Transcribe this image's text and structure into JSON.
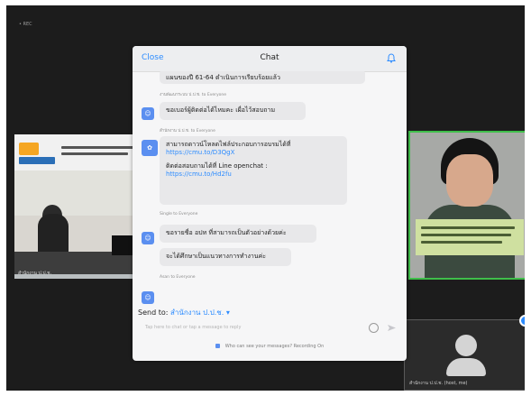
{
  "app": {
    "top_left_label": "• REC"
  },
  "left_video": {
    "label": "สำนักงาน ป.ป.ช."
  },
  "right_video": {
    "sign_text": ""
  },
  "self_view": {
    "label": "สำนักงาน ป.ป.ช. (host, me)"
  },
  "chat": {
    "close_label": "Close",
    "title": "Chat",
    "messages": [
      {
        "sender": "",
        "text": "แผนของปี 61-64 ดำเนินการเรียบร้อยแล้ว"
      },
      {
        "sender": "งานพัฒนาระบบ ป.ป.ช. to Everyone",
        "text": "ขอเบอร์ผู้ติดต่อได้ไหมคะ เผื่อไว้สอบถาม"
      },
      {
        "sender": "สำนักงาน ป.ป.ช. to Everyone",
        "text": "สามารถดาวน์โหลดไฟล์ประกอบการอบรมได้ที่ ",
        "link": "https://cmu.to/D3QgX",
        "text2": "ติดต่อสอบถามได้ที่ Line openchat :",
        "link2": "https://cmu.to/Hd2fu"
      },
      {
        "sender": "Single to Everyone",
        "text": "ขอรายชื่อ อปท ที่สามารถเป็นตัวอย่างด้วยค่ะ",
        "text2": "จะได้ศึกษาเป็นแนวทางการทำงานค่ะ"
      },
      {
        "sender": "Asan to Everyone",
        "text": ""
      }
    ],
    "send_to_label": "Send to:",
    "send_to_target": "สำนักงาน ป.ป.ช. ▾",
    "input_placeholder": "Tap here to chat or tap a message to reply",
    "footer_text": "Who can see your messages? Recording On"
  }
}
